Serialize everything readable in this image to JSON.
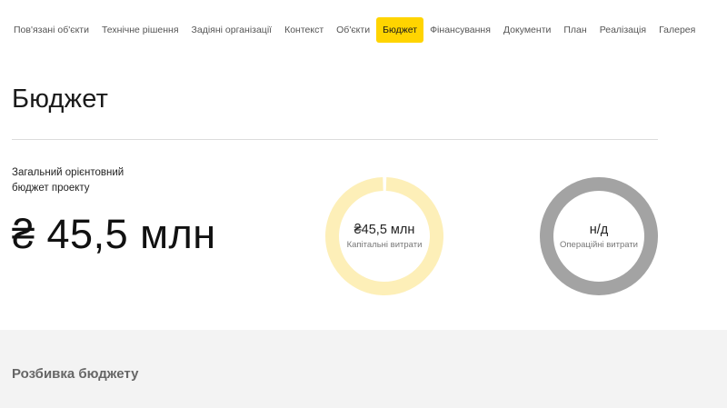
{
  "nav": {
    "tabs": [
      {
        "label": "Пов'язані об'єкти",
        "active": false
      },
      {
        "label": "Технічне рішення",
        "active": false
      },
      {
        "label": "Задіяні організації",
        "active": false
      },
      {
        "label": "Контекст",
        "active": false
      },
      {
        "label": "Об'єкти",
        "active": false
      },
      {
        "label": "Бюджет",
        "active": true
      },
      {
        "label": "Фінансування",
        "active": false
      },
      {
        "label": "Документи",
        "active": false
      },
      {
        "label": "План",
        "active": false
      },
      {
        "label": "Реалізація",
        "active": false
      },
      {
        "label": "Галерея",
        "active": false
      }
    ]
  },
  "page": {
    "title": "Бюджет"
  },
  "total": {
    "label": "Загальний орієнтовний бюджет проекту",
    "value": "₴ 45,5 млн"
  },
  "rings": {
    "capital": {
      "value": "₴45,5 млн",
      "caption": "Капітальні витрати",
      "share": 1.0,
      "color": "#fdefb8"
    },
    "operating": {
      "value": "н/д",
      "caption": "Операційні витрати",
      "share": 1.0,
      "color": "#a3a3a3"
    }
  },
  "breakdown": {
    "title": "Розбивка бюджету"
  },
  "colors": {
    "accent": "#ffd400",
    "section_bg": "#f3f3f3"
  }
}
